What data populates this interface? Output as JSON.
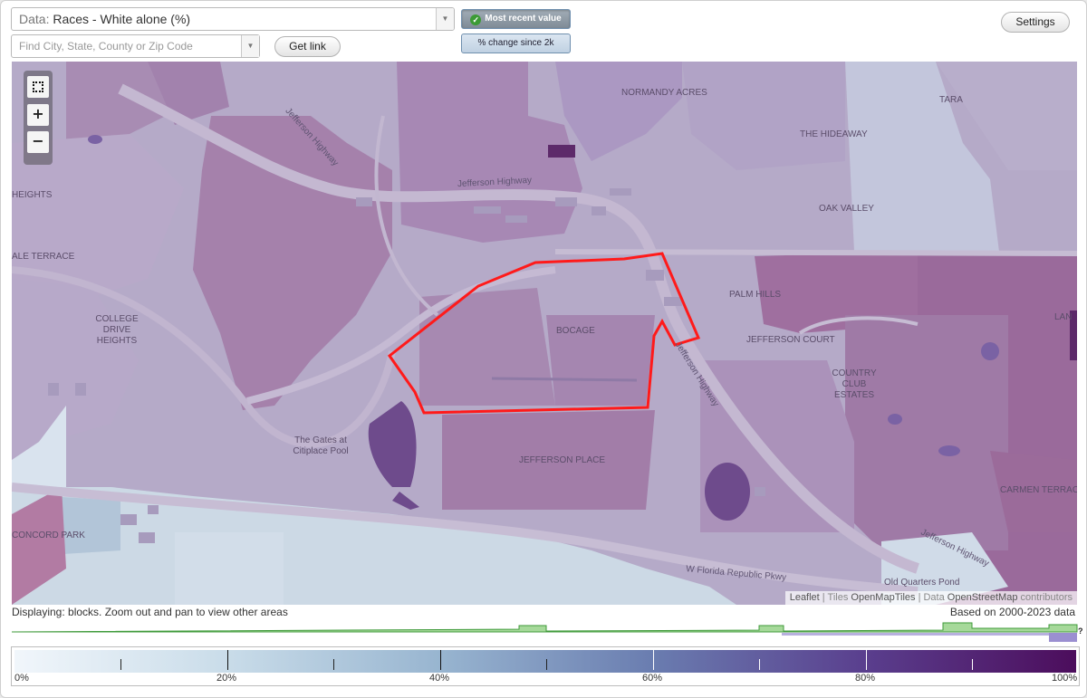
{
  "toolbar": {
    "data_prefix": "Data:",
    "data_value": "Races - White alone (%)",
    "search_placeholder": "Find City, State, County or Zip Code",
    "get_link_label": "Get link",
    "mode_recent_label": "Most recent value",
    "mode_change_label": "% change since 2k",
    "settings_label": "Settings"
  },
  "map": {
    "controls": {
      "fullscreen": "fullscreen-icon",
      "zoom_in": "+",
      "zoom_out": "−"
    },
    "places": {
      "normandy_acres": "NORMANDY ACRES",
      "tara": "TARA",
      "the_hideaway": "THE HIDEAWAY",
      "oak_valley": "OAK VALLEY",
      "heights": "HEIGHTS",
      "ale_terrace": "ALE TERRACE",
      "college_drive_heights": "COLLEGE DRIVE HEIGHTS",
      "palm_hills": "PALM HILLS",
      "bocage": "BOCAGE",
      "jefferson_court": "JEFFERSON COURT",
      "country_club_estates": "COUNTRY CLUB ESTATES",
      "lan": "LAN",
      "the_gates": "The Gates at Citiplace Pool",
      "jefferson_place": "JEFFERSON PLACE",
      "carmen_terrace": "CARMEN TERRACE",
      "concord_park": "CONCORD PARK",
      "old_quarters_pond": "Old Quarters Pond"
    },
    "roads": {
      "jefferson_highway_a": "Jefferson Highway",
      "jefferson_highway_b": "Jefferson Highway",
      "jefferson_highway_c": "Jefferson Highway",
      "jefferson_highway_d": "Jefferson Highway",
      "w_florida": "W Florida Republic Pkwy"
    },
    "attribution": {
      "leaflet": "Leaflet",
      "tiles_prefix": "| Tiles",
      "tiles": "OpenMapTiles",
      "data_prefix": "| Data",
      "data": "OpenStreetMap",
      "suffix": "contributors"
    },
    "colors": {
      "highlight_outline": "#ff1a1a"
    }
  },
  "status": {
    "displaying": "Displaying: blocks. Zoom out and pan to view other areas",
    "based_on": "Based on 2000-2023 data"
  },
  "legend": {
    "labels": [
      "0%",
      "20%",
      "40%",
      "60%",
      "80%",
      "100%"
    ],
    "qmark": "?",
    "colors": [
      "#f1f6fb",
      "#c9dce9",
      "#98b5d0",
      "#6a7db0",
      "#5a3f8e",
      "#4c0d5c"
    ]
  }
}
